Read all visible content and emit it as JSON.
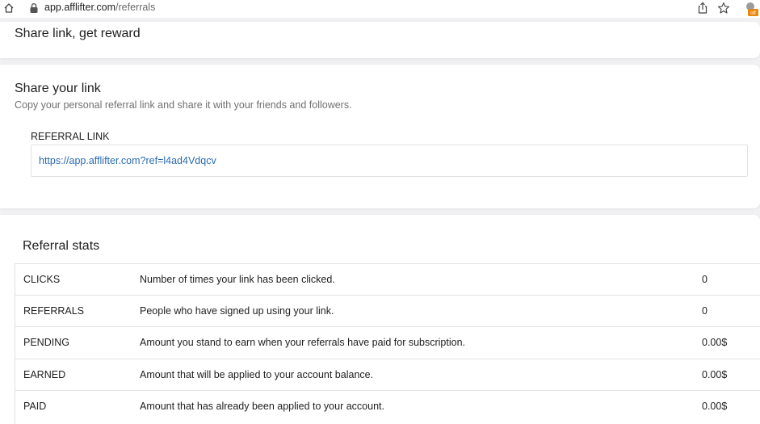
{
  "browser": {
    "url_host": "app.afflifter.com",
    "url_path": "/referrals",
    "extension_badge": "off",
    "icons": [
      "home-icon",
      "lock-icon",
      "share-icon",
      "star-icon",
      "extension-icon"
    ]
  },
  "reward_section": {
    "title": "Share link, get reward"
  },
  "share_section": {
    "title": "Share your link",
    "subtitle": "Copy your personal referral link and share it with your friends and followers.",
    "referral_label": "REFERRAL LINK",
    "referral_link": "https://app.afflifter.com?ref=l4ad4Vdqcv"
  },
  "stats_section": {
    "title": "Referral stats",
    "rows": [
      {
        "name": "CLICKS",
        "description": "Number of times your link has been clicked.",
        "value": "0"
      },
      {
        "name": "REFERRALS",
        "description": "People who have signed up using your link.",
        "value": "0"
      },
      {
        "name": "PENDING",
        "description": "Amount you stand to earn when your referrals have paid for subscription.",
        "value": "0.00$"
      },
      {
        "name": "EARNED",
        "description": "Amount that will be applied to your account balance.",
        "value": "0.00$"
      },
      {
        "name": "PAID",
        "description": "Amount that has already been applied to your account.",
        "value": "0.00$"
      }
    ]
  },
  "colors": {
    "link": "#2b6cb0",
    "page_background": "#f1f1f3",
    "extension_badge": "#e8870e"
  }
}
